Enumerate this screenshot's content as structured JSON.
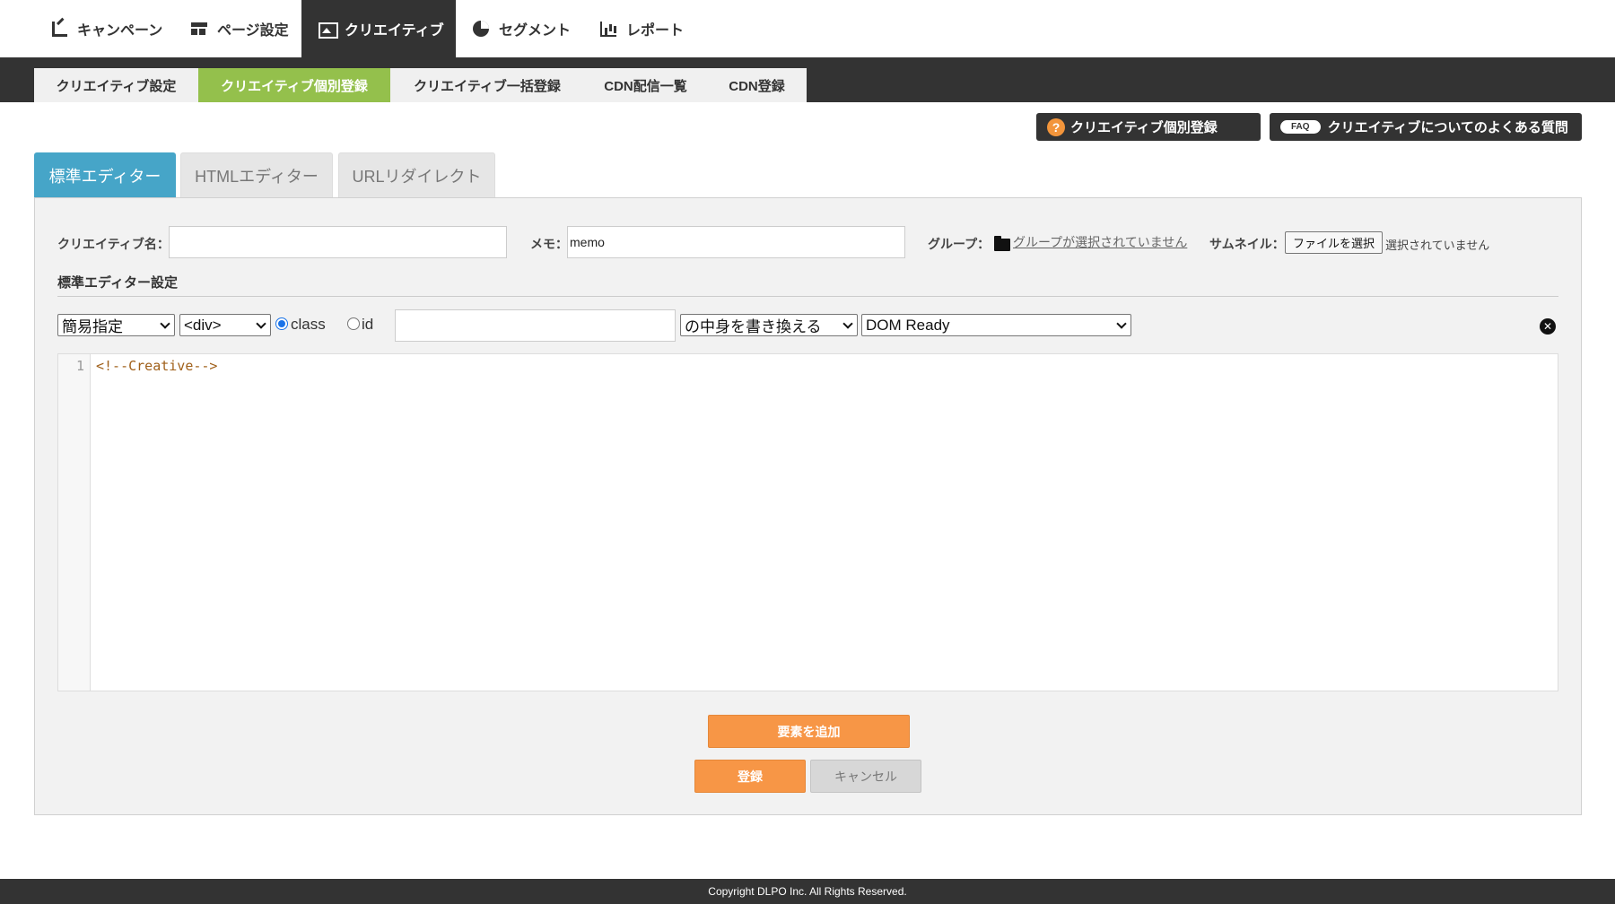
{
  "topnav": {
    "items": [
      {
        "label": "キャンペーン",
        "icon": "chart-line-icon"
      },
      {
        "label": "ページ設定",
        "icon": "layout-icon"
      },
      {
        "label": "クリエイティブ",
        "icon": "image-icon",
        "active": true
      },
      {
        "label": "セグメント",
        "icon": "pie-chart-icon"
      },
      {
        "label": "レポート",
        "icon": "bar-chart-icon"
      }
    ]
  },
  "subtabs": [
    {
      "label": "クリエイティブ設定"
    },
    {
      "label": "クリエイティブ個別登録",
      "active": true
    },
    {
      "label": "クリエイティブ一括登録"
    },
    {
      "label": "CDN配信一覧"
    },
    {
      "label": "CDN登録"
    }
  ],
  "help": {
    "help_label": "クリエイティブ個別登録",
    "help_icon": "?",
    "faq_badge": "FAQ",
    "faq_label": "クリエイティブについてのよくある質問"
  },
  "editor_tabs": [
    {
      "label": "標準エディター",
      "active": true
    },
    {
      "label": "HTMLエディター"
    },
    {
      "label": "URLリダイレクト"
    }
  ],
  "form": {
    "name_label": "クリエイティブ名：",
    "name_value": "",
    "memo_label": "メモ：",
    "memo_value": "memo",
    "group_label": "グループ：",
    "group_link": "グループが選択されていません",
    "thumb_label": "サムネイル：",
    "file_button": "ファイルを選択",
    "file_status": "選択されていません"
  },
  "settings": {
    "title": "標準エディター設定",
    "mode_select": "簡易指定",
    "tag_select": "<div>",
    "radio_class": "class",
    "radio_id": "id",
    "selector_value": "",
    "action_select": "の中身を書き換える",
    "timing_select": "DOM Ready",
    "close_glyph": "✕"
  },
  "code": {
    "line_number": "1",
    "line_text": "<!--Creative-->"
  },
  "buttons": {
    "add_element": "要素を追加",
    "register": "登録",
    "cancel": "キャンセル"
  },
  "footer": {
    "copyright": "Copyright DLPO Inc. All Rights Reserved."
  },
  "colors": {
    "accent_green": "#94c04c",
    "accent_blue": "#46a5c8",
    "accent_orange": "#f79646",
    "dark": "#333333"
  }
}
